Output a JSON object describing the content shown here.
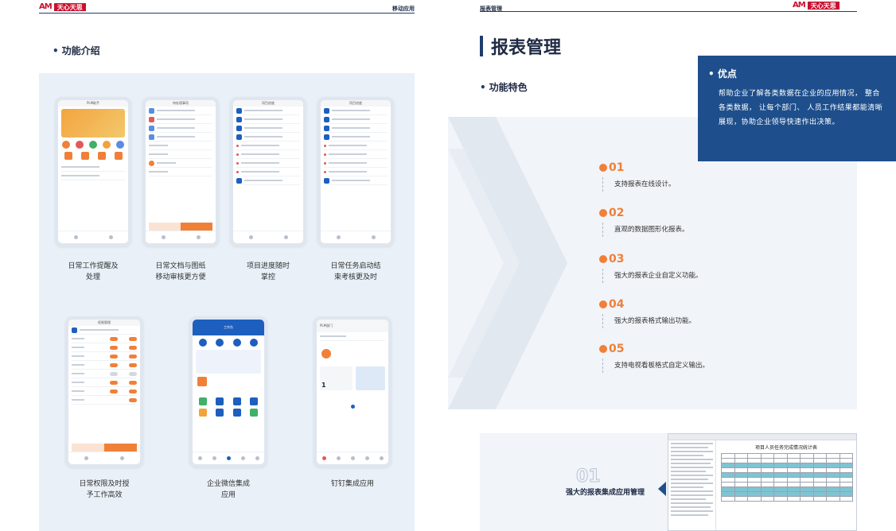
{
  "brand": {
    "mark": "AM",
    "name": "天心天思"
  },
  "left": {
    "header_label": "移动应用",
    "section_title": "功能介绍",
    "captions": [
      [
        "日常工作提醒及",
        "处理"
      ],
      [
        "日常文档与图纸",
        "移动审核更方便"
      ],
      [
        "项目进度随时",
        "掌控"
      ],
      [
        "日常任务启动结",
        "束考核更及时"
      ],
      [
        "日常权限及时授",
        "予工作高效"
      ],
      [
        "企业微信集成",
        "应用"
      ],
      [
        "钉钉集成应用"
      ]
    ],
    "phones": {
      "p1_title": "PLM助手",
      "p2_title": "待处理事项",
      "p3_title": "项目进度",
      "p4_title": "项目进度",
      "p5_title": "权限管理",
      "p6_title": "工作台",
      "p7_title": "PLM部门",
      "p7_card_value": "1"
    }
  },
  "right": {
    "header_label": "报表管理",
    "title": "报表管理",
    "section_title": "功能特色",
    "advantage": {
      "title": "优点",
      "body": "帮助企业了解各类数据在企业的应用情况， 整合各类数据， 让每个部门、 人员工作结果都能清晰展现，协助企业领导快速作出决策。"
    },
    "features": [
      {
        "num": "01",
        "text": "支持报表在线设计。"
      },
      {
        "num": "02",
        "text": "直观的数据图形化报表。"
      },
      {
        "num": "03",
        "text": "强大的报表企业自定义功能。"
      },
      {
        "num": "04",
        "text": "强大的报表格式输出功能。"
      },
      {
        "num": "05",
        "text": "支持电视看板格式自定义输出。"
      }
    ],
    "bottom": {
      "num": "01",
      "label": "强大的报表集成应用管理",
      "report_title": "项目人员任务完成情况统计表"
    }
  },
  "colors": {
    "accent_red": "#c8102e",
    "navy": "#1e4f8c",
    "orange": "#f08038",
    "panel_bg": "#e9f0f7"
  }
}
